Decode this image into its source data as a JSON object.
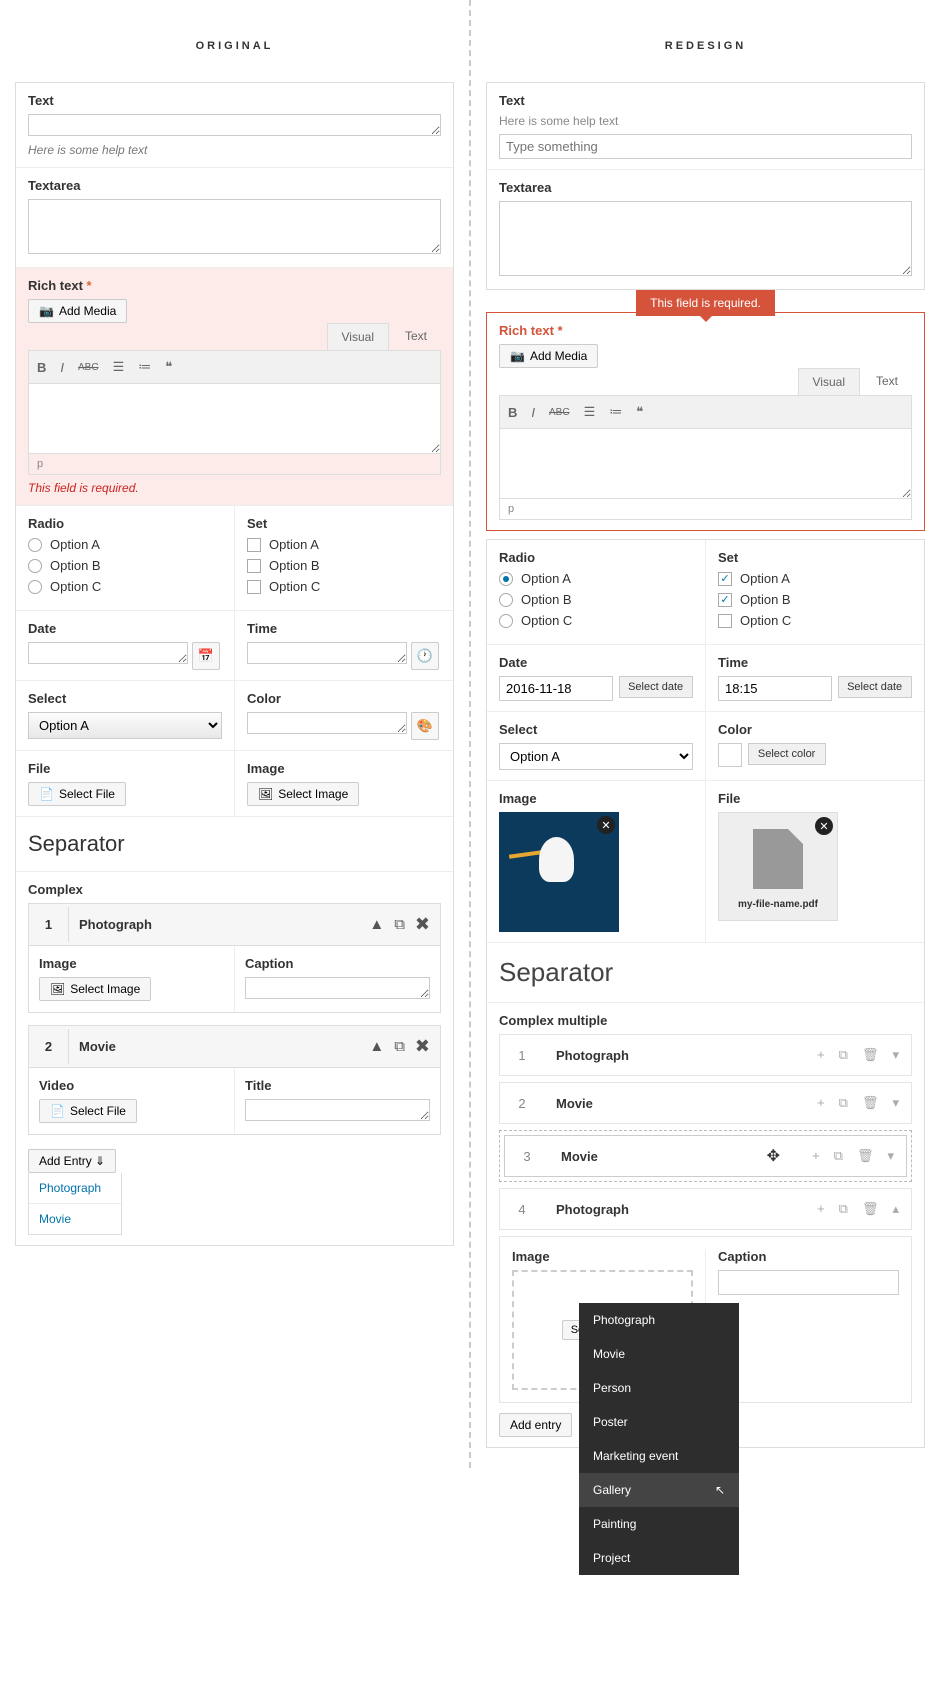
{
  "headings": {
    "original": "ORIGINAL",
    "redesign": "REDESIGN"
  },
  "labels": {
    "text": "Text",
    "textarea": "Textarea",
    "rich": "Rich text",
    "radio": "Radio",
    "set": "Set",
    "date": "Date",
    "time": "Time",
    "select": "Select",
    "color": "Color",
    "file": "File",
    "image": "Image",
    "separator": "Separator",
    "complex": "Complex",
    "caption": "Caption",
    "video": "Video",
    "title": "Title",
    "complex_multi": "Complex multiple"
  },
  "helpText": "Here is some help text",
  "placeholder": "Type something",
  "required": "*",
  "addMedia": "Add Media",
  "tabs": {
    "visual": "Visual",
    "text": "Text"
  },
  "errorMsg": "This field is required.",
  "options": [
    "Option A",
    "Option B",
    "Option C"
  ],
  "selectFile": "Select File",
  "selectImage": "Select Image",
  "selectDate": "Select date",
  "selectColor": "Select color",
  "selectImageBtn": "Select image",
  "selectVal": "Option A",
  "editorP": "p",
  "orig_complex": [
    {
      "num": "1",
      "title": "Photograph"
    },
    {
      "num": "2",
      "title": "Movie"
    }
  ],
  "addEntry": "Add Entry ⇓",
  "addEntryR": "Add entry",
  "addOptions": [
    "Photograph",
    "Movie"
  ],
  "r_date": "2016-11-18",
  "r_time": "18:15",
  "fileName": "my-file-name.pdf",
  "r_complex": [
    {
      "num": "1",
      "title": "Photograph"
    },
    {
      "num": "2",
      "title": "Movie"
    },
    {
      "num": "3",
      "title": "Movie"
    },
    {
      "num": "4",
      "title": "Photograph"
    }
  ],
  "menu": [
    "Photograph",
    "Movie",
    "Person",
    "Poster",
    "Marketing event",
    "Gallery",
    "Painting",
    "Project"
  ]
}
